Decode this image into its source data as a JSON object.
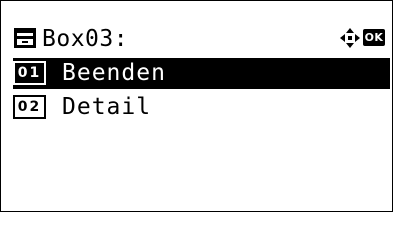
{
  "header": {
    "title": "Box03:",
    "icon": "document-box-icon",
    "nav_icon": "four-way-arrow-icon",
    "ok_label": "OK"
  },
  "menu": {
    "items": [
      {
        "number": "01",
        "label": "Beenden",
        "selected": true
      },
      {
        "number": "02",
        "label": "Detail",
        "selected": false
      }
    ]
  }
}
